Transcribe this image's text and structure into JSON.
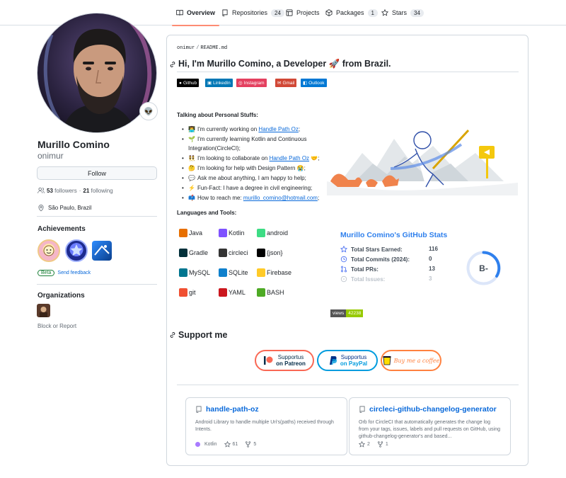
{
  "nav": {
    "tabs": [
      {
        "label": "Overview",
        "count": null
      },
      {
        "label": "Repositories",
        "count": "24"
      },
      {
        "label": "Projects",
        "count": null
      },
      {
        "label": "Packages",
        "count": "1"
      },
      {
        "label": "Stars",
        "count": "34"
      }
    ]
  },
  "profile": {
    "fullname": "Murillo Comino",
    "login": "onimur",
    "status_emoji": "👽",
    "follow_label": "Follow",
    "followers_count": "53",
    "followers_label": "followers",
    "following_count": "21",
    "following_label": "following",
    "separator": "·",
    "location": "São Paulo, Brazil"
  },
  "achievements": {
    "title": "Achievements",
    "beta_label": "Beta",
    "feedback_label": "Send feedback"
  },
  "organizations": {
    "title": "Organizations",
    "block_report": "Block or Report"
  },
  "readme": {
    "path_user": "onimur",
    "path_sep": "/",
    "path_file": "README.md",
    "heading": "Hi, I'm Murillo Comino, a Developer 🚀 from Brazil.",
    "shields": [
      {
        "label": "Github",
        "color": "#000000"
      },
      {
        "label": "LinkedIn",
        "color": "#0077b5"
      },
      {
        "label": "Instagram",
        "color": "#e4405f"
      },
      {
        "label": "Gmail",
        "color": "#d14836"
      },
      {
        "label": "Outlook",
        "color": "#0078d4"
      }
    ],
    "talking_title": "Talking about Personal Stuffs:",
    "bullets": [
      {
        "emoji": "👨‍💻",
        "text": "I'm currently working on ",
        "link": "Handle Path Oz",
        "after": ";"
      },
      {
        "emoji": "🌱",
        "text": "I'm currently learning Kotlin and Continuous Integration(CircleCI);",
        "link": "",
        "after": ""
      },
      {
        "emoji": "👯",
        "text": "I'm looking to collaborate on ",
        "link": "Handle Path Oz",
        "after": " 🤝;"
      },
      {
        "emoji": "🤔",
        "text": "I'm looking for help with Design Pattern 😭;",
        "link": "",
        "after": ""
      },
      {
        "emoji": "💬",
        "text": "Ask me about anything, I am happy to help;",
        "link": "",
        "after": ""
      },
      {
        "emoji": "⚡",
        "text": "Fun-Fact: I have a degree in civil engineering;",
        "link": "",
        "after": ""
      },
      {
        "emoji": "📫",
        "text": "How to reach me: ",
        "link": "murillo_comino@hotmail.com",
        "after": ";"
      }
    ],
    "tools_title": "Languages and Tools:",
    "tools": [
      {
        "label": "Java",
        "color": "#e76f00"
      },
      {
        "label": "Kotlin",
        "color": "#7f52ff"
      },
      {
        "label": "android",
        "color": "#3ddc84"
      },
      {
        "label": "Gradle",
        "color": "#02303a"
      },
      {
        "label": "circleci",
        "color": "#343434"
      },
      {
        "label": "{json}",
        "color": "#000000"
      },
      {
        "label": "MySQL",
        "color": "#00758f"
      },
      {
        "label": "SQLite",
        "color": "#0f80cc"
      },
      {
        "label": "Firebase",
        "color": "#ffca28"
      },
      {
        "label": "git",
        "color": "#f05032"
      },
      {
        "label": "YAML",
        "color": "#cb171e"
      },
      {
        "label": "BASH",
        "color": "#4eaa25"
      }
    ],
    "views_label": "views",
    "views_count": "42238",
    "support_heading": "Support me",
    "support_buttons": [
      {
        "line1": "Supportus",
        "line2": "on Patreon",
        "color": "#f96854"
      },
      {
        "line1": "Supportus",
        "line2": "on PayPal",
        "color": "#009cde"
      },
      {
        "line1": "Buy me a coffee",
        "line2": "",
        "color": "#ff813f"
      }
    ]
  },
  "stats": {
    "title": "Murillo Comino's GitHub Stats",
    "rows": [
      {
        "label": "Total Stars Earned:",
        "value": "116"
      },
      {
        "label": "Total Commits (2024):",
        "value": "0"
      },
      {
        "label": "Total PRs:",
        "value": "13"
      },
      {
        "label": "Total Issues:",
        "value": "3"
      }
    ],
    "grade": "B-",
    "accent": "#2f80ed"
  },
  "pinned": [
    {
      "name": "handle-path-oz",
      "description": "Android Library to handle multiple Uri's(paths) received through Intents.",
      "language": "Kotlin",
      "language_color": "#a97bff",
      "stars": "61",
      "forks": "5"
    },
    {
      "name": "circleci-github-changelog-generator",
      "description": "Orb for CircleCI that automatically generates the change log from your tags, issues, labels and pull requests on GitHub, using github-changelog-generator's and based...",
      "language": "",
      "language_color": "",
      "stars": "2",
      "forks": "1"
    }
  ]
}
